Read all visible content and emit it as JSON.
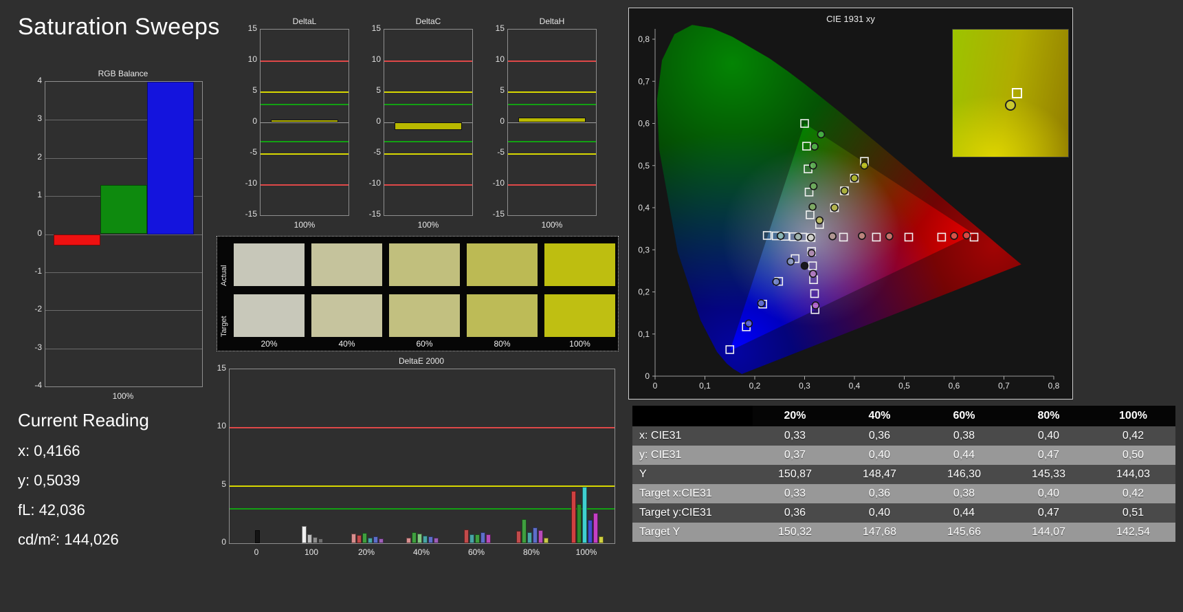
{
  "page_title": "Saturation Sweeps",
  "current_reading": {
    "heading": "Current Reading",
    "x": "x: 0,4166",
    "y": "y: 0,5039",
    "fl": "fL: 42,036",
    "cdm2": "cd/m²: 144,026"
  },
  "chart_data": {
    "rgb_balance": {
      "type": "bar",
      "title": "RGB Balance",
      "xlabel": "100%",
      "ylim": [
        -4,
        4
      ],
      "yticks": [
        4,
        3,
        2,
        1,
        0,
        -1,
        -2,
        -3,
        -4
      ],
      "bars": [
        {
          "name": "red",
          "value": -0.3,
          "color": "#ee1111"
        },
        {
          "name": "green",
          "value": 1.3,
          "color": "#0e8a0e"
        },
        {
          "name": "blue",
          "value": 4.0,
          "color": "#1414dd"
        }
      ]
    },
    "delta_charts": {
      "type": "bar",
      "ylim": [
        -15,
        15
      ],
      "yticks": [
        15,
        10,
        5,
        0,
        -5,
        -10,
        -15
      ],
      "limit_lines": [
        {
          "value": 10,
          "color": "#e04848"
        },
        {
          "value": -10,
          "color": "#e04848"
        },
        {
          "value": 5,
          "color": "#d8d800"
        },
        {
          "value": -5,
          "color": "#d8d800"
        },
        {
          "value": 3,
          "color": "#13a013"
        },
        {
          "value": -3,
          "color": "#13a013"
        }
      ],
      "xlabel": "100%",
      "bar_color": "#b9b900",
      "charts": [
        {
          "title": "DeltaL",
          "value": 0.4
        },
        {
          "title": "DeltaC",
          "value": -1.2
        },
        {
          "title": "DeltaH",
          "value": 0.8
        }
      ]
    },
    "saturation_swatches": {
      "row_labels": [
        "Actual",
        "Target"
      ],
      "col_labels": [
        "20%",
        "40%",
        "60%",
        "80%",
        "100%"
      ],
      "actual": [
        "#c7c7b9",
        "#c5c39c",
        "#c1bf7d",
        "#bcba54",
        "#bebe10"
      ],
      "target": [
        "#c8c8ba",
        "#c6c49e",
        "#c2c080",
        "#bdbb57",
        "#bfbf12"
      ]
    },
    "deltae2000": {
      "type": "bar",
      "title": "DeltaE 2000",
      "ylim": [
        0,
        15
      ],
      "yticks": [
        0,
        5,
        10,
        15
      ],
      "limit_lines": [
        {
          "value": 10,
          "color": "#e04848"
        },
        {
          "value": 5,
          "color": "#d8d800"
        },
        {
          "value": 3,
          "color": "#13a013"
        }
      ],
      "groups": [
        {
          "label": "0",
          "bars": [
            {
              "v": 1.15,
              "c": "#141414"
            }
          ]
        },
        {
          "label": "100",
          "bars": [
            {
              "v": 1.5,
              "c": "#f0f0f0"
            },
            {
              "v": 0.75,
              "c": "#bdbdbd"
            },
            {
              "v": 0.55,
              "c": "#8f8f8f"
            },
            {
              "v": 0.4,
              "c": "#6f6f6f"
            }
          ]
        },
        {
          "label": "20%",
          "bars": [
            {
              "v": 0.85,
              "c": "#d98f8f"
            },
            {
              "v": 0.7,
              "c": "#c24b4b"
            },
            {
              "v": 0.9,
              "c": "#3f9f3f"
            },
            {
              "v": 0.5,
              "c": "#49a5a5"
            },
            {
              "v": 0.6,
              "c": "#5e6ec9"
            },
            {
              "v": 0.4,
              "c": "#9e5eb9"
            }
          ]
        },
        {
          "label": "40%",
          "bars": [
            {
              "v": 0.5,
              "c": "#d98f8f"
            },
            {
              "v": 0.95,
              "c": "#3f9f3f"
            },
            {
              "v": 0.85,
              "c": "#7fc97f"
            },
            {
              "v": 0.65,
              "c": "#49a5a5"
            },
            {
              "v": 0.6,
              "c": "#5e6ec9"
            },
            {
              "v": 0.45,
              "c": "#9e5eb9"
            }
          ]
        },
        {
          "label": "60%",
          "bars": [
            {
              "v": 1.2,
              "c": "#c24b4b"
            },
            {
              "v": 0.8,
              "c": "#49a5a5"
            },
            {
              "v": 0.75,
              "c": "#3f9f3f"
            },
            {
              "v": 0.95,
              "c": "#5e6ec9"
            },
            {
              "v": 0.8,
              "c": "#b94bb9"
            }
          ]
        },
        {
          "label": "80%",
          "bars": [
            {
              "v": 1.05,
              "c": "#c24b4b"
            },
            {
              "v": 2.1,
              "c": "#3f9f3f"
            },
            {
              "v": 0.95,
              "c": "#49a5a5"
            },
            {
              "v": 1.35,
              "c": "#5e6ec9"
            },
            {
              "v": 1.15,
              "c": "#b94bb9"
            },
            {
              "v": 0.45,
              "c": "#c9c94b"
            }
          ]
        },
        {
          "label": "100%",
          "bars": [
            {
              "v": 4.5,
              "c": "#d04040"
            },
            {
              "v": 3.4,
              "c": "#2c8a2c"
            },
            {
              "v": 4.85,
              "c": "#3fd0d0"
            },
            {
              "v": 2.0,
              "c": "#3f4fd0"
            },
            {
              "v": 2.6,
              "c": "#c43fc4"
            },
            {
              "v": 0.6,
              "c": "#d0d040"
            }
          ]
        }
      ]
    },
    "cie1931": {
      "type": "scatter",
      "title": "CIE 1931 xy",
      "xlim": [
        0,
        0.8
      ],
      "ylim": [
        0,
        0.8
      ],
      "xtick_labels": [
        "0",
        "0,1",
        "0,2",
        "0,3",
        "0,4",
        "0,5",
        "0,6",
        "0,7",
        "0,8"
      ],
      "ytick_labels": [
        "0",
        "0,1",
        "0,2",
        "0,3",
        "0,4",
        "0,5",
        "0,6",
        "0,7",
        "0,8"
      ],
      "target_squares": [
        [
          0.313,
          0.329
        ],
        [
          0.378,
          0.33
        ],
        [
          0.444,
          0.33
        ],
        [
          0.509,
          0.33
        ],
        [
          0.575,
          0.33
        ],
        [
          0.64,
          0.33
        ],
        [
          0.311,
          0.383
        ],
        [
          0.309,
          0.437
        ],
        [
          0.307,
          0.492
        ],
        [
          0.304,
          0.546
        ],
        [
          0.3,
          0.6
        ],
        [
          0.281,
          0.279
        ],
        [
          0.248,
          0.225
        ],
        [
          0.216,
          0.171
        ],
        [
          0.183,
          0.117
        ],
        [
          0.15,
          0.063
        ],
        [
          0.296,
          0.33
        ],
        [
          0.278,
          0.331
        ],
        [
          0.261,
          0.332
        ],
        [
          0.243,
          0.333
        ],
        [
          0.225,
          0.334
        ],
        [
          0.314,
          0.296
        ],
        [
          0.316,
          0.262
        ],
        [
          0.318,
          0.229
        ],
        [
          0.32,
          0.196
        ],
        [
          0.321,
          0.158
        ],
        [
          0.33,
          0.36
        ],
        [
          0.36,
          0.4
        ],
        [
          0.38,
          0.44
        ],
        [
          0.4,
          0.47
        ],
        [
          0.42,
          0.51
        ]
      ],
      "measured_circles": [
        {
          "p": [
            0.33,
            0.37
          ],
          "c": "#b9b95a"
        },
        {
          "p": [
            0.36,
            0.4
          ],
          "c": "#b9b94a"
        },
        {
          "p": [
            0.38,
            0.44
          ],
          "c": "#b0b83e"
        },
        {
          "p": [
            0.4,
            0.47
          ],
          "c": "#b4bc30"
        },
        {
          "p": [
            0.42,
            0.5
          ],
          "c": "#bcc020"
        },
        {
          "p": [
            0.316,
            0.402
          ],
          "c": "#7fae62"
        },
        {
          "p": [
            0.318,
            0.451
          ],
          "c": "#6fae5d"
        },
        {
          "p": [
            0.317,
            0.5
          ],
          "c": "#5fae55"
        },
        {
          "p": [
            0.32,
            0.545
          ],
          "c": "#54b14e"
        },
        {
          "p": [
            0.333,
            0.574
          ],
          "c": "#49b549"
        },
        {
          "p": [
            0.356,
            0.332
          ],
          "c": "#b59a92"
        },
        {
          "p": [
            0.415,
            0.333
          ],
          "c": "#c08a80"
        },
        {
          "p": [
            0.47,
            0.332
          ],
          "c": "#cc7a70"
        },
        {
          "p": [
            0.6,
            0.333
          ],
          "c": "#d85a50"
        },
        {
          "p": [
            0.625,
            0.334
          ],
          "c": "#dc5048"
        },
        {
          "p": [
            0.287,
            0.331
          ],
          "c": "#9ab0a8"
        },
        {
          "p": [
            0.252,
            0.333
          ],
          "c": "#84b2b0"
        },
        {
          "p": [
            0.272,
            0.272
          ],
          "c": "#8898c0"
        },
        {
          "p": [
            0.243,
            0.224
          ],
          "c": "#7888c8"
        },
        {
          "p": [
            0.213,
            0.173
          ],
          "c": "#6874d0"
        },
        {
          "p": [
            0.188,
            0.125
          ],
          "c": "#5c64d8"
        },
        {
          "p": [
            0.314,
            0.292
          ],
          "c": "#b08cb0"
        },
        {
          "p": [
            0.317,
            0.243
          ],
          "c": "#b47cc0"
        },
        {
          "p": [
            0.322,
            0.168
          ],
          "c": "#b868cc"
        },
        {
          "p": [
            0.3,
            0.262
          ],
          "c": "#101010"
        },
        {
          "p": [
            0.3127,
            0.329
          ],
          "c": "#d8d8d0"
        }
      ],
      "inset": {
        "circle": [
          0.45,
          0.55
        ],
        "square": [
          0.51,
          0.46
        ],
        "circle_color": "#c9c930"
      }
    },
    "measurement_table": {
      "col_headers": [
        "20%",
        "40%",
        "60%",
        "80%",
        "100%"
      ],
      "rows": [
        {
          "label": "x: CIE31",
          "values": [
            "0,33",
            "0,36",
            "0,38",
            "0,40",
            "0,42"
          ]
        },
        {
          "label": "y: CIE31",
          "values": [
            "0,37",
            "0,40",
            "0,44",
            "0,47",
            "0,50"
          ]
        },
        {
          "label": "Y",
          "values": [
            "150,87",
            "148,47",
            "146,30",
            "145,33",
            "144,03"
          ]
        },
        {
          "label": "Target x:CIE31",
          "values": [
            "0,33",
            "0,36",
            "0,38",
            "0,40",
            "0,42"
          ]
        },
        {
          "label": "Target y:CIE31",
          "values": [
            "0,36",
            "0,40",
            "0,44",
            "0,47",
            "0,51"
          ]
        },
        {
          "label": "Target Y",
          "values": [
            "150,32",
            "147,68",
            "145,66",
            "144,07",
            "142,54"
          ]
        }
      ]
    }
  }
}
